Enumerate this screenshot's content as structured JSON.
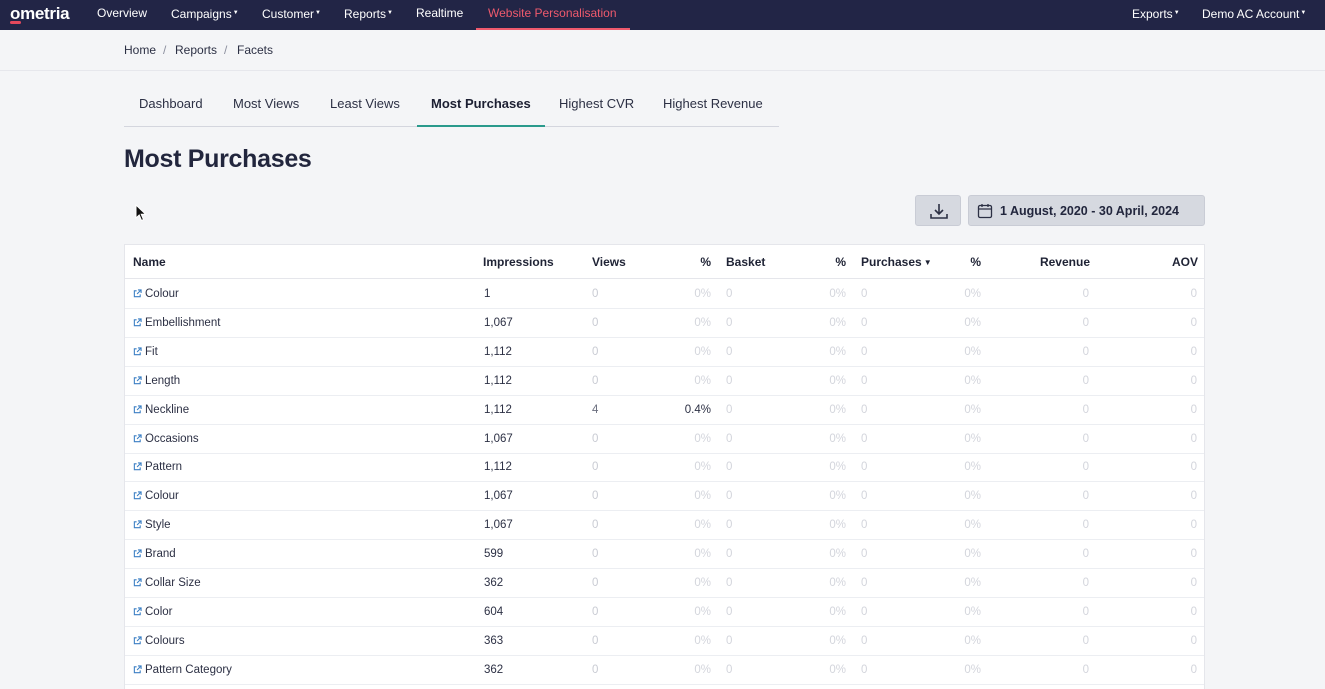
{
  "app": {
    "logo": "ometria"
  },
  "nav": {
    "items": [
      {
        "label": "Overview",
        "caret": false
      },
      {
        "label": "Campaigns",
        "caret": true
      },
      {
        "label": "Customer",
        "caret": true
      },
      {
        "label": "Reports",
        "caret": true
      },
      {
        "label": "Realtime",
        "caret": false
      },
      {
        "label": "Website Personalisation",
        "caret": false
      }
    ],
    "active": "Website Personalisation",
    "right": [
      {
        "label": "Exports",
        "caret": true
      },
      {
        "label": "Demo AC Account",
        "caret": true
      }
    ],
    "caret_glyph": "▼"
  },
  "breadcrumb": {
    "items": [
      "Home",
      "Reports",
      "Facets"
    ],
    "separator": "/"
  },
  "tabs": {
    "items": [
      "Dashboard",
      "Most Views",
      "Least Views",
      "Most Purchases",
      "Highest CVR",
      "Highest Revenue"
    ],
    "active": "Most Purchases"
  },
  "page": {
    "title": "Most Purchases"
  },
  "actions": {
    "download_icon": "download-icon",
    "date_range": "1 August, 2020 - 30 April, 2024",
    "calendar_icon": "calendar-icon"
  },
  "table": {
    "columns": {
      "name": "Name",
      "impressions": "Impressions",
      "views": "Views",
      "views_pct": "%",
      "basket": "Basket",
      "basket_pct": "%",
      "purchases": "Purchases",
      "purchases_pct": "%",
      "revenue": "Revenue",
      "aov": "AOV"
    },
    "sorted_by": "purchases",
    "sort_direction": "descending",
    "sort_icon": "▼",
    "rows": [
      {
        "name": "Colour",
        "impressions": "1",
        "views": "0",
        "views_pct": "0%",
        "basket": "0",
        "basket_pct": "0%",
        "purchases": "0",
        "purchases_pct": "0%",
        "revenue": "0",
        "aov": "0"
      },
      {
        "name": "Embellishment",
        "impressions": "1,067",
        "views": "0",
        "views_pct": "0%",
        "basket": "0",
        "basket_pct": "0%",
        "purchases": "0",
        "purchases_pct": "0%",
        "revenue": "0",
        "aov": "0"
      },
      {
        "name": "Fit",
        "impressions": "1,112",
        "views": "0",
        "views_pct": "0%",
        "basket": "0",
        "basket_pct": "0%",
        "purchases": "0",
        "purchases_pct": "0%",
        "revenue": "0",
        "aov": "0"
      },
      {
        "name": "Length",
        "impressions": "1,112",
        "views": "0",
        "views_pct": "0%",
        "basket": "0",
        "basket_pct": "0%",
        "purchases": "0",
        "purchases_pct": "0%",
        "revenue": "0",
        "aov": "0"
      },
      {
        "name": "Neckline",
        "impressions": "1,112",
        "views": "4",
        "views_pct": "0.4%",
        "basket": "0",
        "basket_pct": "0%",
        "purchases": "0",
        "purchases_pct": "0%",
        "revenue": "0",
        "aov": "0"
      },
      {
        "name": "Occasions",
        "impressions": "1,067",
        "views": "0",
        "views_pct": "0%",
        "basket": "0",
        "basket_pct": "0%",
        "purchases": "0",
        "purchases_pct": "0%",
        "revenue": "0",
        "aov": "0"
      },
      {
        "name": "Pattern",
        "impressions": "1,112",
        "views": "0",
        "views_pct": "0%",
        "basket": "0",
        "basket_pct": "0%",
        "purchases": "0",
        "purchases_pct": "0%",
        "revenue": "0",
        "aov": "0"
      },
      {
        "name": "Colour",
        "impressions": "1,067",
        "views": "0",
        "views_pct": "0%",
        "basket": "0",
        "basket_pct": "0%",
        "purchases": "0",
        "purchases_pct": "0%",
        "revenue": "0",
        "aov": "0"
      },
      {
        "name": "Style",
        "impressions": "1,067",
        "views": "0",
        "views_pct": "0%",
        "basket": "0",
        "basket_pct": "0%",
        "purchases": "0",
        "purchases_pct": "0%",
        "revenue": "0",
        "aov": "0"
      },
      {
        "name": "Brand",
        "impressions": "599",
        "views": "0",
        "views_pct": "0%",
        "basket": "0",
        "basket_pct": "0%",
        "purchases": "0",
        "purchases_pct": "0%",
        "revenue": "0",
        "aov": "0"
      },
      {
        "name": "Collar Size",
        "impressions": "362",
        "views": "0",
        "views_pct": "0%",
        "basket": "0",
        "basket_pct": "0%",
        "purchases": "0",
        "purchases_pct": "0%",
        "revenue": "0",
        "aov": "0"
      },
      {
        "name": "Color",
        "impressions": "604",
        "views": "0",
        "views_pct": "0%",
        "basket": "0",
        "basket_pct": "0%",
        "purchases": "0",
        "purchases_pct": "0%",
        "revenue": "0",
        "aov": "0"
      },
      {
        "name": "Colours",
        "impressions": "363",
        "views": "0",
        "views_pct": "0%",
        "basket": "0",
        "basket_pct": "0%",
        "purchases": "0",
        "purchases_pct": "0%",
        "revenue": "0",
        "aov": "0"
      },
      {
        "name": "Pattern Category",
        "impressions": "362",
        "views": "0",
        "views_pct": "0%",
        "basket": "0",
        "basket_pct": "0%",
        "purchases": "0",
        "purchases_pct": "0%",
        "revenue": "0",
        "aov": "0"
      }
    ]
  },
  "colors": {
    "nav_bg": "#222546",
    "accent": "#ef5a6d",
    "tab_accent": "#2a9a8c",
    "muted": "#d3d5dc"
  }
}
